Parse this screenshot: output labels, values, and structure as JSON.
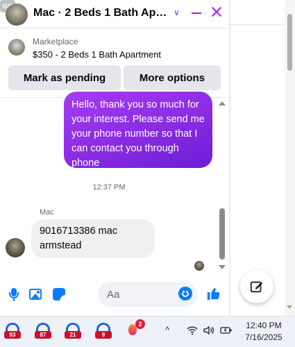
{
  "header": {
    "title": "Mac · 2 Beds 1 Bath Apart..."
  },
  "marketplace": {
    "label": "Marketplace",
    "listing": "$350 - 2 Beds 1 Bath Apartment",
    "mark_pending_label": "Mark as pending",
    "more_options_label": "More options"
  },
  "messages": {
    "outgoing_text": "Hello, thank you so much for your interest. Please send me your phone number so that I can contact you through phone",
    "timestamp": "12:37 PM",
    "sender_name": "Mac",
    "incoming_text": "9016713386 mac armstead"
  },
  "composer": {
    "gif_label": "GIF",
    "placeholder": "Aa"
  },
  "taskbar": {
    "apps": [
      {
        "badge": "93",
        "icon": "browser-app-icon"
      },
      {
        "badge": "87",
        "icon": "browser-app-icon"
      },
      {
        "badge": "21",
        "icon": "browser-app-icon"
      },
      {
        "badge": "9",
        "icon": "browser-app-icon"
      }
    ],
    "flame_badge": "2",
    "chevron": "^",
    "time": "12:40 PM",
    "date": "7/16/2025"
  },
  "colors": {
    "accent": "#a020f0",
    "messenger_blue": "#0a7cff",
    "bubble_gradient_start": "#a53df2",
    "bubble_gradient_end": "#6a1fd6"
  }
}
